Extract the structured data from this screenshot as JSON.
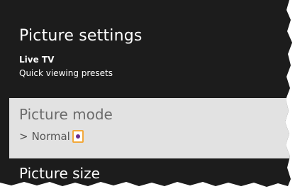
{
  "header": {
    "title": "Picture settings",
    "context": "Live TV",
    "description": "Quick viewing presets"
  },
  "menu": {
    "picture_mode": {
      "label": "Picture mode",
      "chevron": ">",
      "value": "Normal",
      "selected": true
    },
    "picture_size": {
      "label": "Picture size"
    }
  },
  "colors": {
    "panel_background": "#1c1c1c",
    "selected_row_background": "#e2e2e2",
    "highlight_border": "#f2a83b",
    "indicator_dot": "#6a2c8f"
  },
  "icons": {
    "value_indicator": "dot-icon",
    "expand": "chevron-right-icon"
  }
}
